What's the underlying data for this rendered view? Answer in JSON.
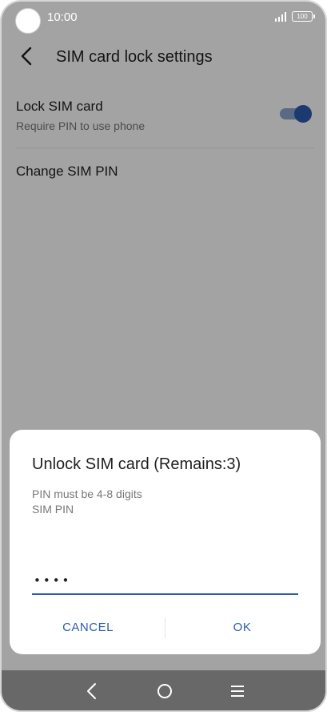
{
  "status_bar": {
    "time": "10:00",
    "battery": "100",
    "icons": [
      "signal-icon",
      "battery-icon"
    ]
  },
  "app_bar": {
    "title": "SIM card lock settings",
    "back_icon": "back-arrow-icon"
  },
  "settings": {
    "lock_sim": {
      "title": "Lock SIM card",
      "subtitle": "Require PIN to use phone",
      "enabled": true
    },
    "change_pin": {
      "title": "Change SIM PIN"
    }
  },
  "dialog": {
    "title": "Unlock SIM card (Remains:3)",
    "hint_line1": "PIN must be 4-8 digits",
    "hint_line2": "SIM PIN",
    "pin_value": "••••",
    "cancel_label": "CANCEL",
    "ok_label": "OK"
  },
  "nav_bar": {
    "icons": [
      "nav-back-icon",
      "nav-home-icon",
      "nav-menu-icon"
    ]
  },
  "colors": {
    "accent": "#2d5bb0",
    "toggle_track": "#8ea4cf",
    "scrim": "rgba(0,0,0,0.36)"
  }
}
